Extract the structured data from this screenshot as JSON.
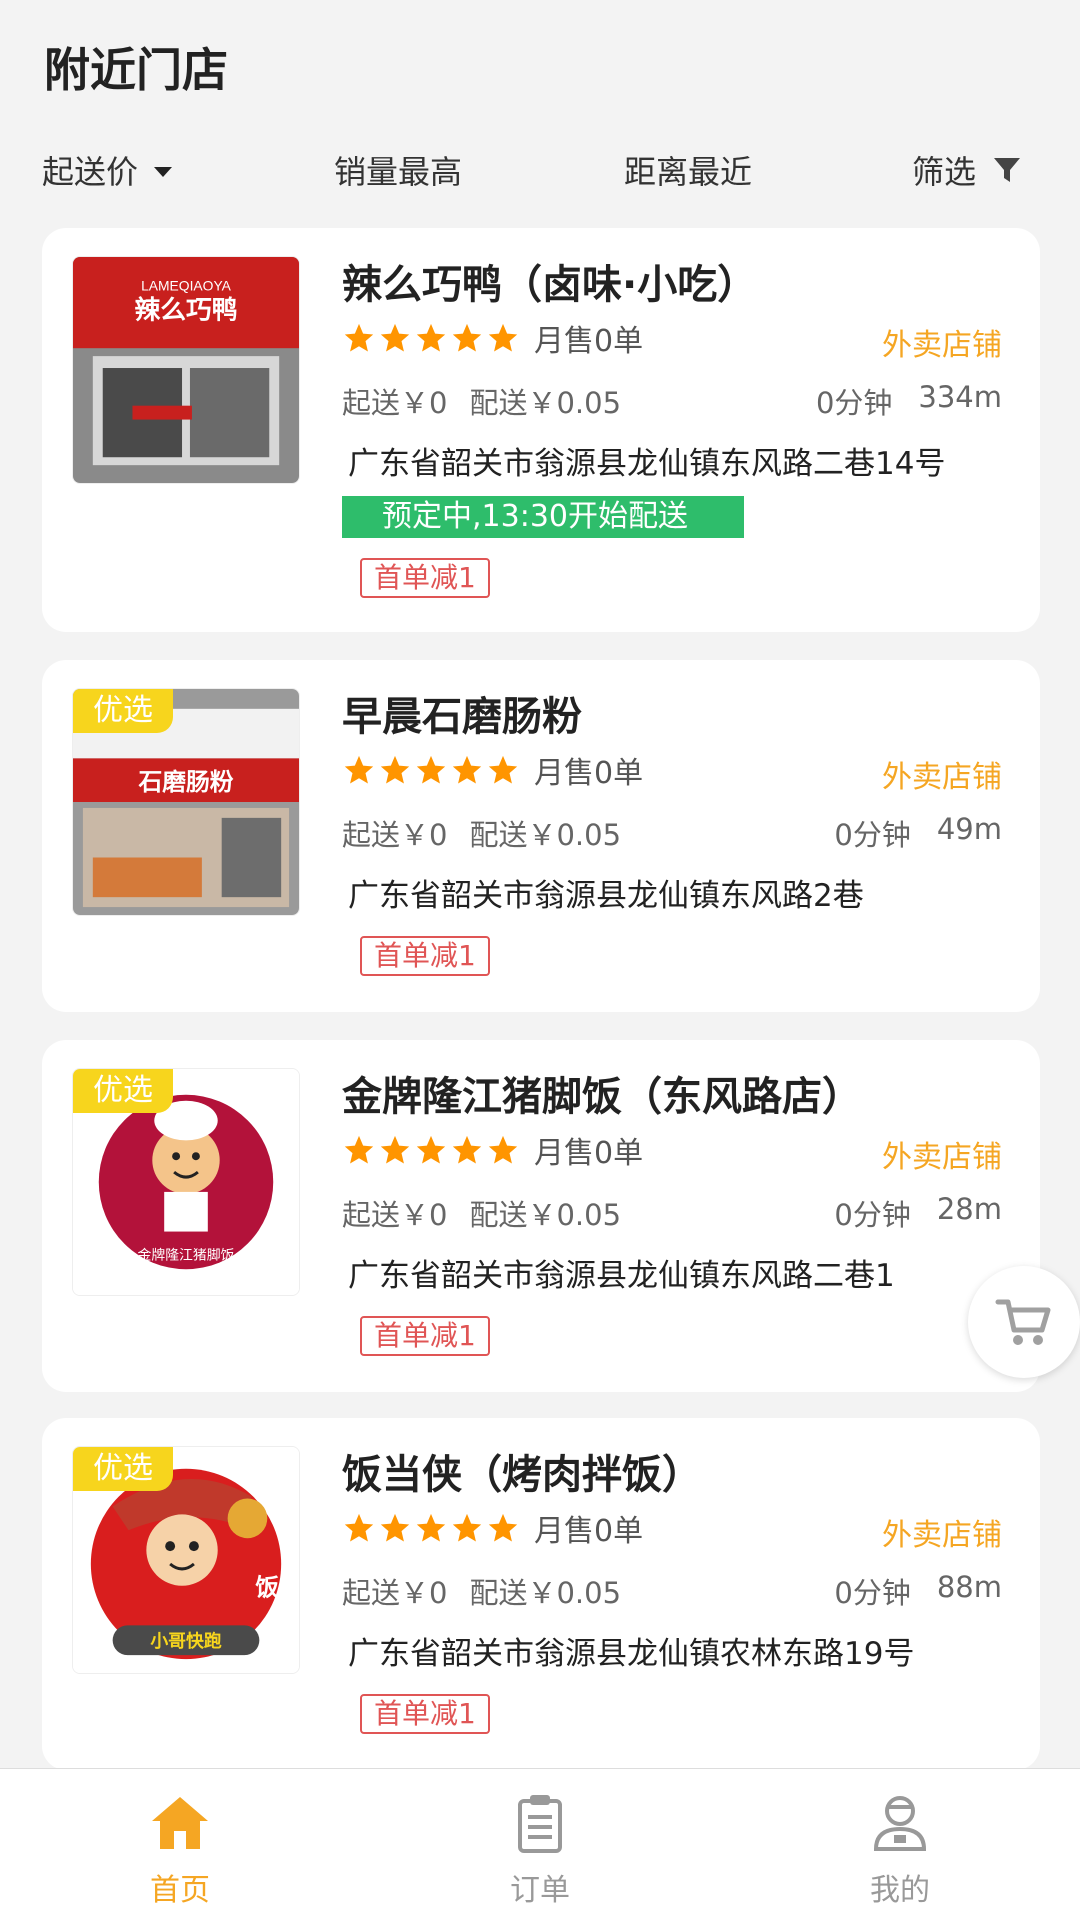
{
  "page": {
    "title": "附近门店"
  },
  "filters": {
    "min_price": "起送价",
    "top_sales": "销量最高",
    "nearest": "距离最近",
    "filter": "筛选"
  },
  "stores": [
    {
      "name": "辣么巧鸭（卤味·小吃）",
      "monthly_sales": "月售0单",
      "type": "外卖店铺",
      "min_order": "起送￥0",
      "delivery_fee": "配送￥0.05",
      "time": "0分钟",
      "distance": "334m",
      "address": "广东省韶关市翁源县龙仙镇东风路二巷14号",
      "preorder": "预定中,13:30开始配送",
      "promo": "首单减1",
      "rating": 5,
      "shop_sign": "辣么巧鸭",
      "shop_sign_en": "LAMEQIAOYA"
    },
    {
      "name": "早晨石磨肠粉",
      "monthly_sales": "月售0单",
      "type": "外卖店铺",
      "min_order": "起送￥0",
      "delivery_fee": "配送￥0.05",
      "time": "0分钟",
      "distance": "49m",
      "address": "广东省韶关市翁源县龙仙镇东风路2巷",
      "badge": "优选",
      "promo": "首单减1",
      "rating": 5,
      "shop_sign": "石磨肠粉"
    },
    {
      "name": "金牌隆江猪脚饭（东风路店）",
      "monthly_sales": "月售0单",
      "type": "外卖店铺",
      "min_order": "起送￥0",
      "delivery_fee": "配送￥0.05",
      "time": "0分钟",
      "distance": "28m",
      "address": "广东省韶关市翁源县龙仙镇东风路二巷1",
      "badge": "优选",
      "promo": "首单减1",
      "rating": 5,
      "logo_text": "金牌隆江猪脚饭"
    },
    {
      "name": "饭当侠（烤肉拌饭）",
      "monthly_sales": "月售0单",
      "type": "外卖店铺",
      "min_order": "起送￥0",
      "delivery_fee": "配送￥0.05",
      "time": "0分钟",
      "distance": "88m",
      "address": "广东省韶关市翁源县龙仙镇农林东路19号",
      "badge": "优选",
      "promo": "首单减1",
      "rating": 5,
      "logo_text": "小哥快跑",
      "logo_char": "饭"
    }
  ],
  "bottom_nav": {
    "home": "首页",
    "orders": "订单",
    "mine": "我的"
  },
  "colors": {
    "accent": "#f5a623",
    "star": "#ff9500",
    "preorder_green": "#2ebd6b",
    "promo_red": "#e05555",
    "badge_yellow": "#f7d51d",
    "nav_inactive": "#999999"
  },
  "icons": {
    "filter": "funnel-icon",
    "cart": "shopping-cart-icon",
    "home": "home-icon",
    "orders": "clipboard-icon",
    "mine": "user-icon"
  }
}
